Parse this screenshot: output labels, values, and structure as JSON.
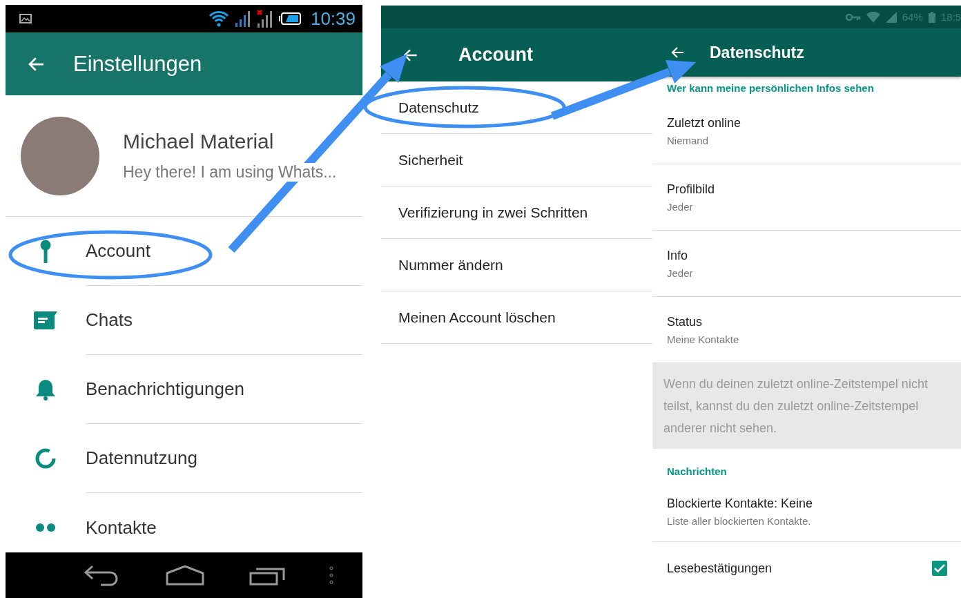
{
  "settings_screen": {
    "status_bar": {
      "time": "10:39"
    },
    "title": "Einstellungen",
    "profile": {
      "name": "Michael Material",
      "status": "Hey there! I am using Whats..."
    },
    "items": [
      {
        "label": "Account"
      },
      {
        "label": "Chats"
      },
      {
        "label": "Benachrichtigungen"
      },
      {
        "label": "Datennutzung"
      },
      {
        "label": "Kontakte"
      }
    ]
  },
  "account_screen": {
    "title": "Account",
    "items": [
      "Datenschutz",
      "Sicherheit",
      "Verifizierung in zwei Schritten",
      "Nummer ändern",
      "Meinen Account löschen"
    ]
  },
  "privacy_screen": {
    "status_bar": {
      "battery": "64%",
      "time": "18:5"
    },
    "title": "Datenschutz",
    "sections": [
      {
        "header": "Wer kann meine persönlichen Infos sehen",
        "items": [
          {
            "kind": "value",
            "title": "Zuletzt online",
            "value": "Niemand"
          },
          {
            "kind": "value",
            "title": "Profilbild",
            "value": "Jeder"
          },
          {
            "kind": "value",
            "title": "Info",
            "value": "Jeder"
          },
          {
            "kind": "value",
            "title": "Status",
            "value": "Meine Kontakte"
          }
        ],
        "note": "Wenn du deinen zuletzt online-Zeitstempel nicht teilst, kannst du den zuletzt online-Zeitstempel anderer nicht sehen."
      },
      {
        "header": "Nachrichten",
        "items": [
          {
            "kind": "value",
            "title": "Blockierte Kontakte: Keine",
            "value": "Liste aller blockierten Kontakte."
          },
          {
            "kind": "checkbox",
            "title": "Lesebestätigungen",
            "checked": true
          }
        ]
      }
    ]
  }
}
